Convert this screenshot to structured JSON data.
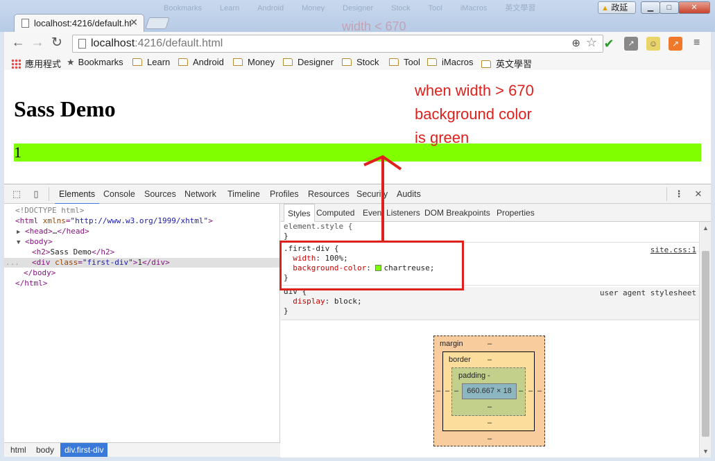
{
  "window": {
    "tab_title": "localhost:4216/default.ht",
    "user_label": "政延",
    "ghost_items": [
      "Bookmarks",
      "Learn",
      "Android",
      "Money",
      "Designer",
      "Stock",
      "Tool",
      "iMacros",
      "英文學習"
    ],
    "ghost_text": "width < 670"
  },
  "toolbar": {
    "url_host": "localhost",
    "url_path": ":4216/default.html"
  },
  "bookmarks": {
    "apps_label": "應用程式",
    "items": [
      "Bookmarks",
      "Learn",
      "Android",
      "Money",
      "Designer",
      "Stock",
      "Tool",
      "iMacros",
      "英文學習"
    ]
  },
  "page": {
    "heading": "Sass Demo",
    "div_text": "1",
    "div_color": "#7fff00"
  },
  "annotation": {
    "lines": [
      "when width > 670",
      "background color",
      "is green"
    ],
    "color": "#e0201c"
  },
  "devtools": {
    "tabs": [
      "Elements",
      "Console",
      "Sources",
      "Network",
      "Timeline",
      "Profiles",
      "Resources",
      "Security",
      "Audits"
    ],
    "active_tab": "Elements",
    "dom": {
      "doctype": "<!DOCTYPE html>",
      "html_open_tag": "html",
      "html_attr": "xmlns",
      "html_attr_val": "\"http://www.w3.org/1999/xhtml\"",
      "head": "head",
      "head_ellipsis": "…",
      "body": "body",
      "h2_text": "Sass Demo",
      "div_class_attr": "class",
      "div_class_val": "\"first-div\"",
      "div_text": "1",
      "ellipsis_marker": "..."
    },
    "breadcrumbs": [
      "html",
      "body",
      "div.first-div"
    ],
    "styles_tabs": [
      "Styles",
      "Computed",
      "Event Listeners",
      "DOM Breakpoints",
      "Properties"
    ],
    "rules": {
      "element_style": "element.style {",
      "close": "}",
      "first_div_selector": ".first-div {",
      "first_div_source": "site.css:1",
      "width_prop": "width",
      "width_val": "100%;",
      "bg_prop": "background-color",
      "bg_val": "chartreuse;",
      "div_selector": "div {",
      "div_source": "user agent stylesheet",
      "display_prop": "display",
      "display_val": "block;"
    },
    "box_model": {
      "margin_label": "margin",
      "border_label": "border",
      "padding_label": "padding",
      "content_size": "660.667 × 18",
      "dash": "–",
      "padding_dash": "-"
    }
  }
}
